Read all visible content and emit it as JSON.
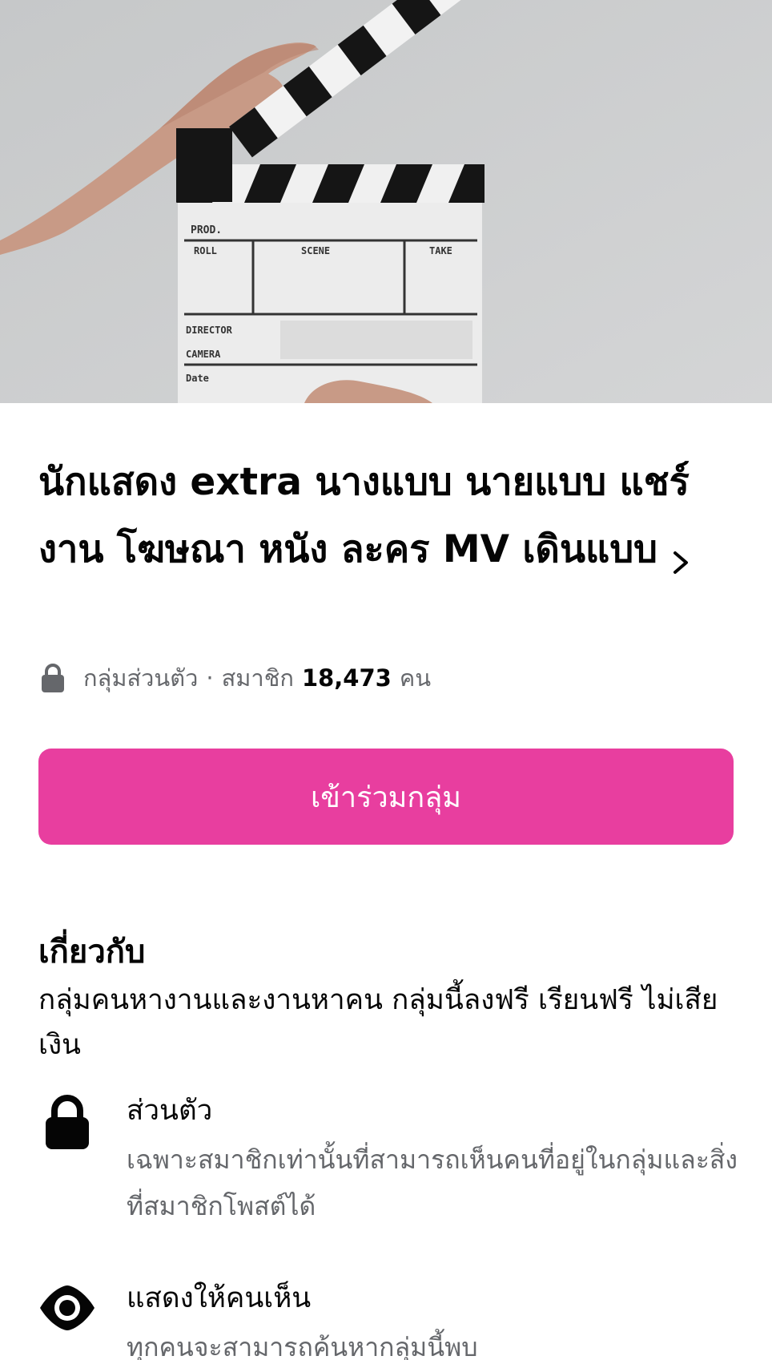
{
  "group": {
    "title": "นักแสดง extra นางแบบ นายแบบ แชร์งาน โฆษณา หนัง ละคร MV เดินแบบ",
    "privacy_label": "กลุ่มส่วนตัว",
    "separator": "·",
    "members_prefix": "สมาชิก",
    "member_count": "18,473",
    "members_suffix": "คน",
    "join_label": "เข้าร่วมกลุ่ม"
  },
  "about": {
    "heading": "เกี่ยวกับ",
    "description": "กลุ่มคนหางานและงานหาคน กลุ่มนี้ลงฟรี เรียนฟรี ไม่เสียเงิน",
    "features": [
      {
        "icon": "lock-icon",
        "title": "ส่วนตัว",
        "description": "เฉพาะสมาชิกเท่านั้นที่สามารถเห็นคนที่อยู่ในกลุ่มและสิ่งที่สมาชิกโพสต์ได้"
      },
      {
        "icon": "eye-icon",
        "title": "แสดงให้คนเห็น",
        "description": "ทุกคนจะสามารถค้นหากลุ่มนี้พบ"
      }
    ]
  },
  "cover": {
    "clapper_labels": [
      "PROD.",
      "ROLL",
      "SCENE",
      "TAKE",
      "DIRECTOR",
      "CAMERA",
      "Date"
    ]
  },
  "colors": {
    "accent": "#e83e9f",
    "secondary_text": "#65676b",
    "primary_text": "#050505"
  }
}
